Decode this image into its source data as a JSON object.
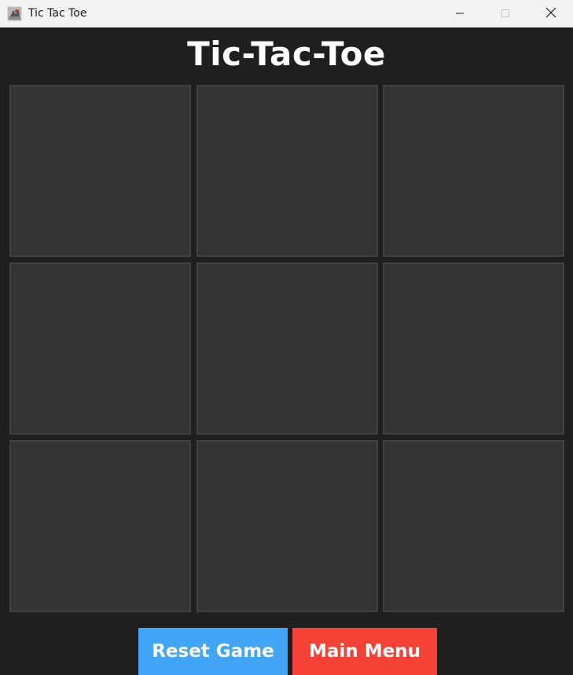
{
  "window": {
    "title": "Tic Tac Toe",
    "icon": "app-icon"
  },
  "heading": "Tic-Tac-Toe",
  "board": {
    "cells": [
      "",
      "",
      "",
      "",
      "",
      "",
      "",
      "",
      ""
    ]
  },
  "buttons": {
    "reset_label": "Reset Game",
    "menu_label": "Main Menu"
  },
  "colors": {
    "background": "#1f1f1f",
    "cell": "#333333",
    "cell_border": "#414141",
    "reset": "#42a5f5",
    "menu": "#f44336"
  }
}
